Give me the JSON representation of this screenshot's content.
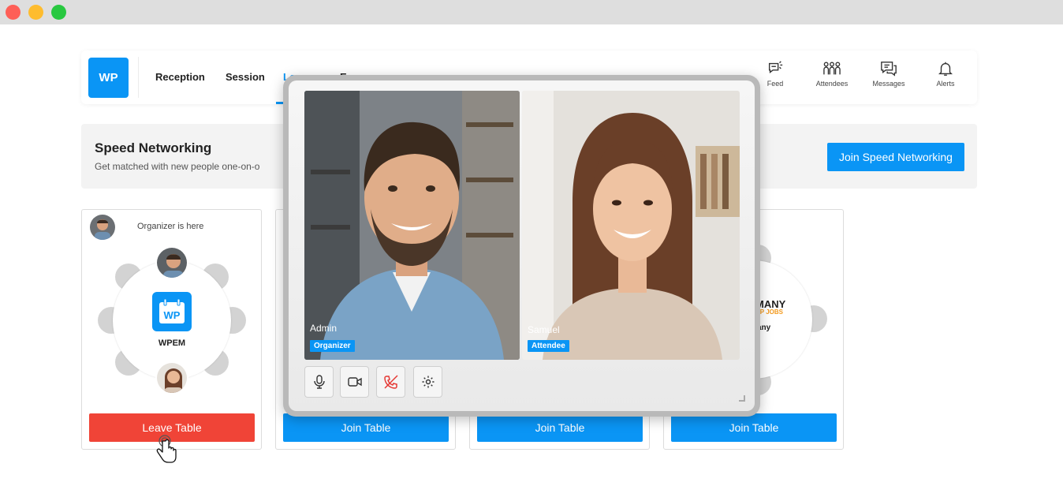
{
  "navbar": {
    "logo": "WP",
    "tabs": [
      {
        "label": "Reception"
      },
      {
        "label": "Session"
      },
      {
        "label": "Lounge"
      },
      {
        "label": "Expo"
      }
    ],
    "icons": [
      {
        "label": "Feed",
        "icon": "feed-icon"
      },
      {
        "label": "Attendees",
        "icon": "attendees-icon"
      },
      {
        "label": "Messages",
        "icon": "messages-icon"
      },
      {
        "label": "Alerts",
        "icon": "bell-icon"
      }
    ]
  },
  "speed_networking": {
    "title": "Speed Networking",
    "subtitle": "Get matched with new people one-on-o",
    "button": "Join Speed Networking"
  },
  "tables": [
    {
      "organizer_text": "Organizer is here",
      "name": "WPEM",
      "logo": "WP",
      "button": "Leave Table"
    },
    {
      "button": "Join Table"
    },
    {
      "button": "Join Table"
    },
    {
      "company_line1": "MANY",
      "company_line2": "UP JOBS",
      "company_label": "any",
      "button": "Join Table"
    }
  ],
  "video_call": {
    "participants": [
      {
        "name": "Admin",
        "role": "Organizer"
      },
      {
        "name": "Samuel",
        "role": "Attendee"
      }
    ],
    "controls": [
      "mic-icon",
      "camera-icon",
      "hangup-icon",
      "settings-icon"
    ]
  },
  "colors": {
    "accent": "#0a95f5",
    "danger": "#f04437",
    "window_close": "#fe5f57",
    "window_minimize": "#febc2e",
    "window_maximize": "#28c840"
  }
}
